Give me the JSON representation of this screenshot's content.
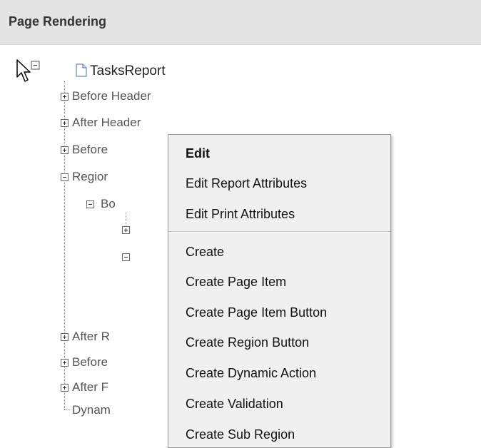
{
  "header": {
    "title": "Page Rendering"
  },
  "tree": {
    "root": {
      "label": "TasksReport",
      "icon": "page-icon"
    },
    "nodes": [
      {
        "label": "Before Header",
        "expanded": false
      },
      {
        "label": "After Header",
        "expanded": false
      },
      {
        "label": "Before",
        "expanded": false
      },
      {
        "label": "Regior",
        "expanded": true
      },
      {
        "label": "Bo",
        "expanded": true
      },
      {
        "label": "After R",
        "expanded": false
      },
      {
        "label": "Before",
        "expanded": false
      },
      {
        "label": "After F",
        "expanded": false
      },
      {
        "label": "Dynam",
        "expanded": null
      }
    ]
  },
  "context_menu": {
    "items": [
      {
        "label": "Edit",
        "bold": true
      },
      {
        "label": "Edit Report Attributes",
        "bold": false
      },
      {
        "label": "Edit Print Attributes",
        "bold": false
      },
      {
        "label": "Create",
        "bold": false
      },
      {
        "label": "Create Page Item",
        "bold": false
      },
      {
        "label": "Create Page Item Button",
        "bold": false
      },
      {
        "label": "Create Region Button",
        "bold": false
      },
      {
        "label": "Create Dynamic Action",
        "bold": false
      },
      {
        "label": "Create Validation",
        "bold": false
      },
      {
        "label": "Create Sub Region",
        "bold": false
      }
    ]
  }
}
